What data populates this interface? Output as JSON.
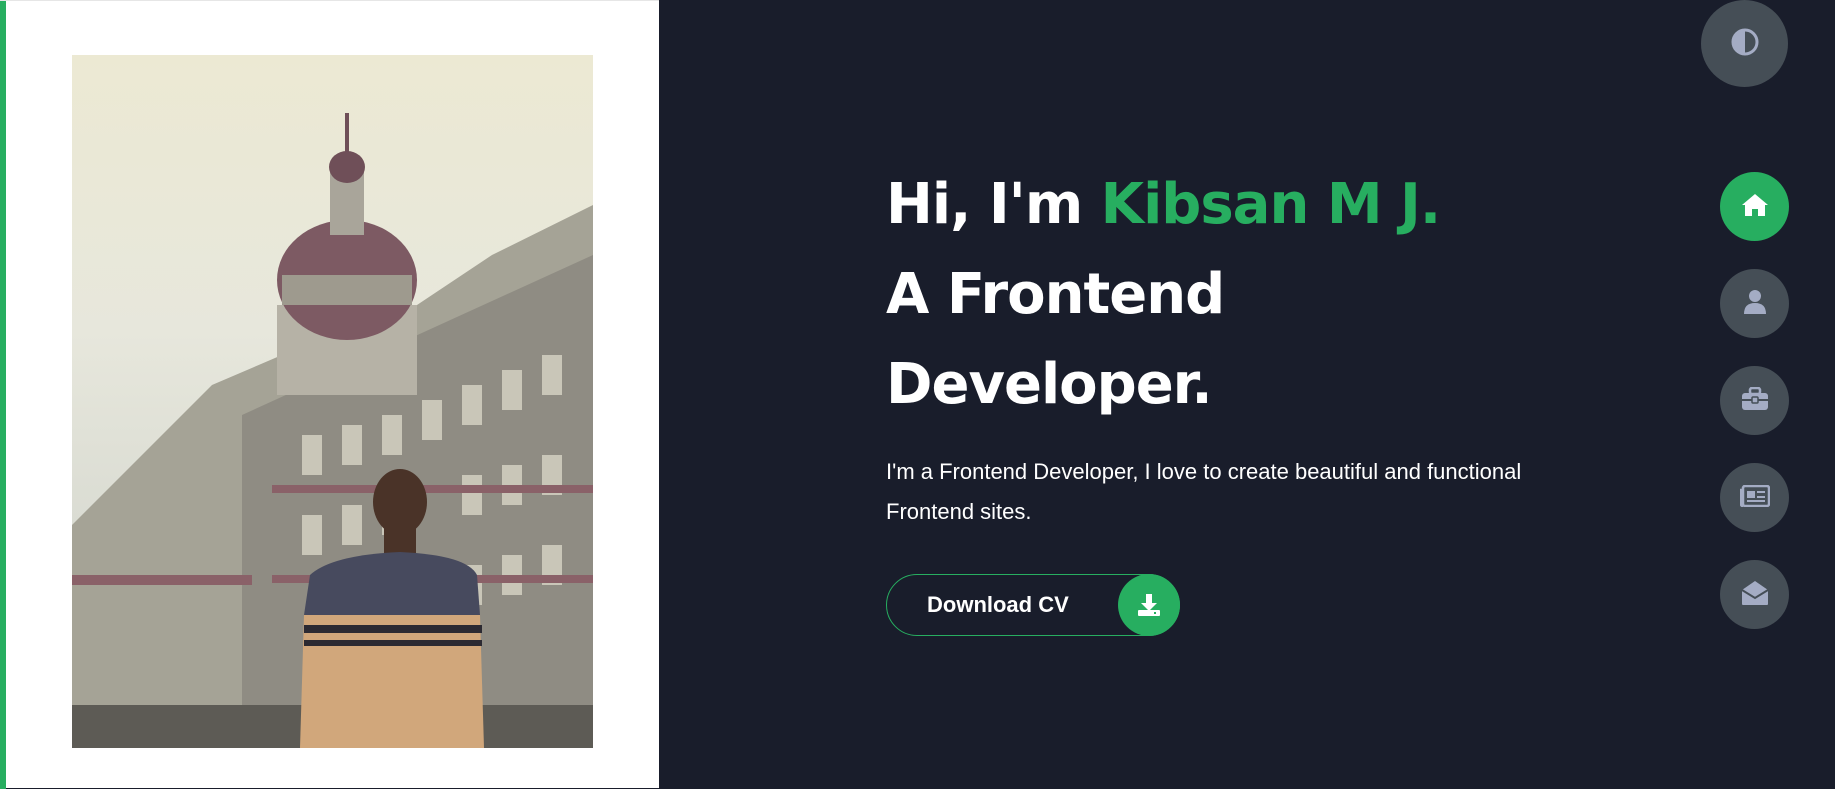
{
  "hero": {
    "greeting": "Hi, I'm",
    "name": "Kibsan M J.",
    "line2": "A Frontend",
    "line3": "Developer.",
    "description": "I'm a Frontend Developer, I love to create beautiful and functional Frontend sites.",
    "cv_button_label": "Download CV"
  },
  "icons": {
    "theme_toggle": "contrast-icon",
    "cv_download": "download-icon",
    "nav": [
      "home-icon",
      "user-icon",
      "briefcase-icon",
      "newspaper-icon",
      "envelope-open-icon"
    ]
  },
  "nav": {
    "active_index": 0,
    "items": [
      "home",
      "about",
      "portfolio",
      "blogs",
      "contact"
    ]
  },
  "colors": {
    "accent": "#27ae60",
    "background": "#191d2b",
    "button_gray": "#454e56",
    "icon_gray": "#a4acc4"
  }
}
